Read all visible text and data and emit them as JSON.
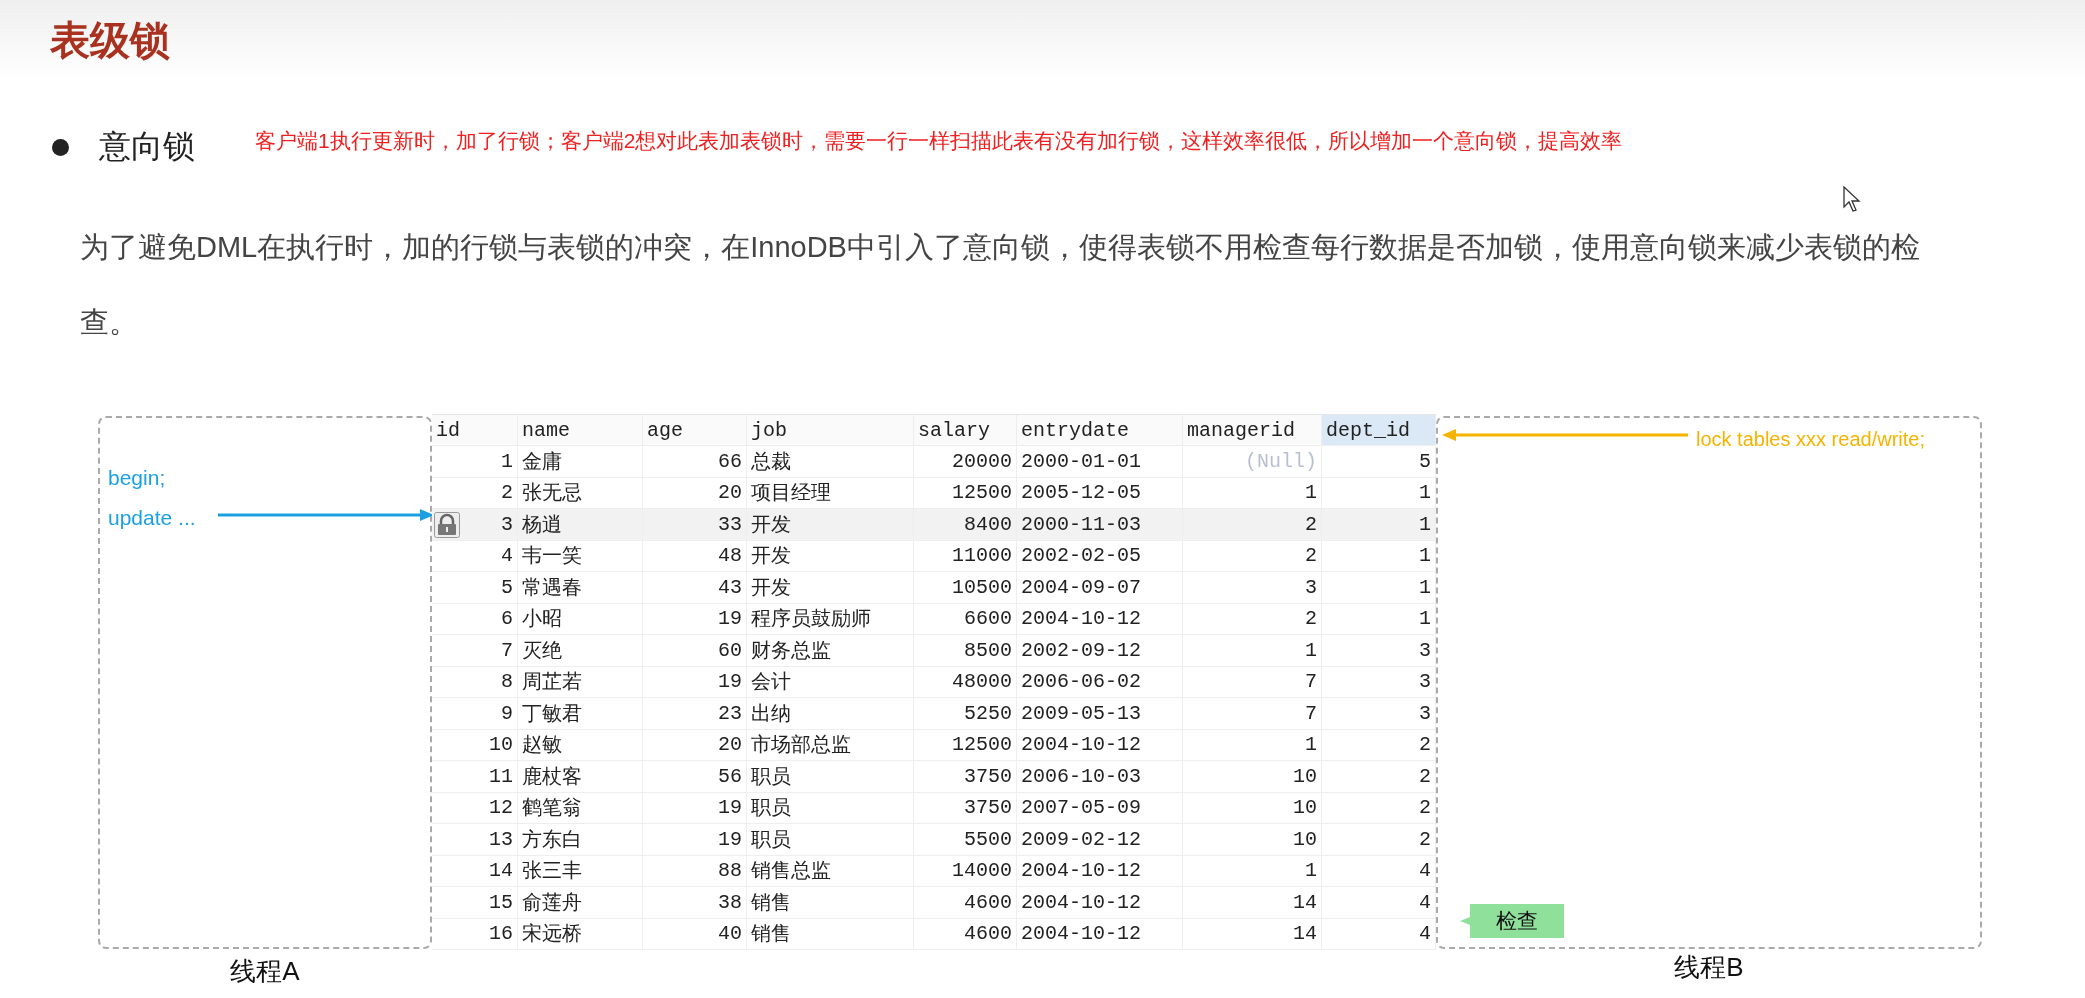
{
  "slide": {
    "title": "表级锁",
    "bullet": {
      "label": "意向锁",
      "note": "客户端1执行更新时，加了行锁；客户端2想对此表加表锁时，需要一行一样扫描此表有没有加行锁，这样效率很低，所以增加一个意向锁，提高效率"
    },
    "paragraph": "为了避免DML在执行时，加的行锁与表锁的冲突，在InnoDB中引入了意向锁，使得表锁不用检查每行数据是否加锁，使用意向锁来减少表锁的检查。"
  },
  "diagram": {
    "thread_a": {
      "lines": [
        "begin;",
        "update ..."
      ],
      "label": "线程A"
    },
    "table": {
      "columns": [
        {
          "label": "id",
          "selected": false
        },
        {
          "label": "name",
          "selected": false
        },
        {
          "label": "age",
          "selected": false
        },
        {
          "label": "job",
          "selected": false
        },
        {
          "label": "salary",
          "selected": false
        },
        {
          "label": "entrydate",
          "selected": false
        },
        {
          "label": "managerid",
          "selected": false
        },
        {
          "label": "dept_id",
          "selected": true
        }
      ],
      "rows": [
        {
          "locked": false,
          "cells": [
            "1",
            "金庸",
            "66",
            "总裁",
            "20000",
            "2000-01-01",
            {
              "text": "(Null)",
              "kind": "null"
            },
            "5"
          ]
        },
        {
          "locked": false,
          "cells": [
            "2",
            "张无忌",
            "20",
            "项目经理",
            "12500",
            "2005-12-05",
            "1",
            "1"
          ]
        },
        {
          "locked": true,
          "cells": [
            "3",
            "杨逍",
            "33",
            "开发",
            "8400",
            "2000-11-03",
            "2",
            "1"
          ]
        },
        {
          "locked": false,
          "cells": [
            "4",
            "韦一笑",
            "48",
            "开发",
            "11000",
            "2002-02-05",
            "2",
            "1"
          ]
        },
        {
          "locked": false,
          "cells": [
            "5",
            "常遇春",
            "43",
            "开发",
            "10500",
            "2004-09-07",
            "3",
            "1"
          ]
        },
        {
          "locked": false,
          "cells": [
            "6",
            "小昭",
            "19",
            "程序员鼓励师",
            "6600",
            "2004-10-12",
            "2",
            "1"
          ]
        },
        {
          "locked": false,
          "cells": [
            "7",
            "灭绝",
            "60",
            "财务总监",
            "8500",
            "2002-09-12",
            "1",
            "3"
          ]
        },
        {
          "locked": false,
          "cells": [
            "8",
            "周芷若",
            "19",
            "会计",
            "48000",
            "2006-06-02",
            "7",
            "3"
          ]
        },
        {
          "locked": false,
          "cells": [
            "9",
            "丁敏君",
            "23",
            "出纳",
            "5250",
            "2009-05-13",
            "7",
            "3"
          ]
        },
        {
          "locked": false,
          "cells": [
            "10",
            "赵敏",
            "20",
            "市场部总监",
            "12500",
            "2004-10-12",
            "1",
            "2"
          ]
        },
        {
          "locked": false,
          "cells": [
            "11",
            "鹿杖客",
            "56",
            "职员",
            "3750",
            "2006-10-03",
            "10",
            "2"
          ]
        },
        {
          "locked": false,
          "cells": [
            "12",
            "鹤笔翁",
            "19",
            "职员",
            "3750",
            "2007-05-09",
            "10",
            "2"
          ]
        },
        {
          "locked": false,
          "cells": [
            "13",
            "方东白",
            "19",
            "职员",
            "5500",
            "2009-02-12",
            "10",
            "2"
          ]
        },
        {
          "locked": false,
          "cells": [
            "14",
            "张三丰",
            "88",
            "销售总监",
            "14000",
            "2004-10-12",
            "1",
            "4"
          ]
        },
        {
          "locked": false,
          "cells": [
            "15",
            "俞莲舟",
            "38",
            "销售",
            "4600",
            "2004-10-12",
            "14",
            "4"
          ]
        },
        {
          "locked": false,
          "cells": [
            "16",
            "宋远桥",
            "40",
            "销售",
            "4600",
            "2004-10-12",
            "14",
            "4"
          ]
        }
      ]
    },
    "thread_b": {
      "command": "lock tables xxx read/write;",
      "callout": "检查",
      "label": "线程B"
    }
  }
}
